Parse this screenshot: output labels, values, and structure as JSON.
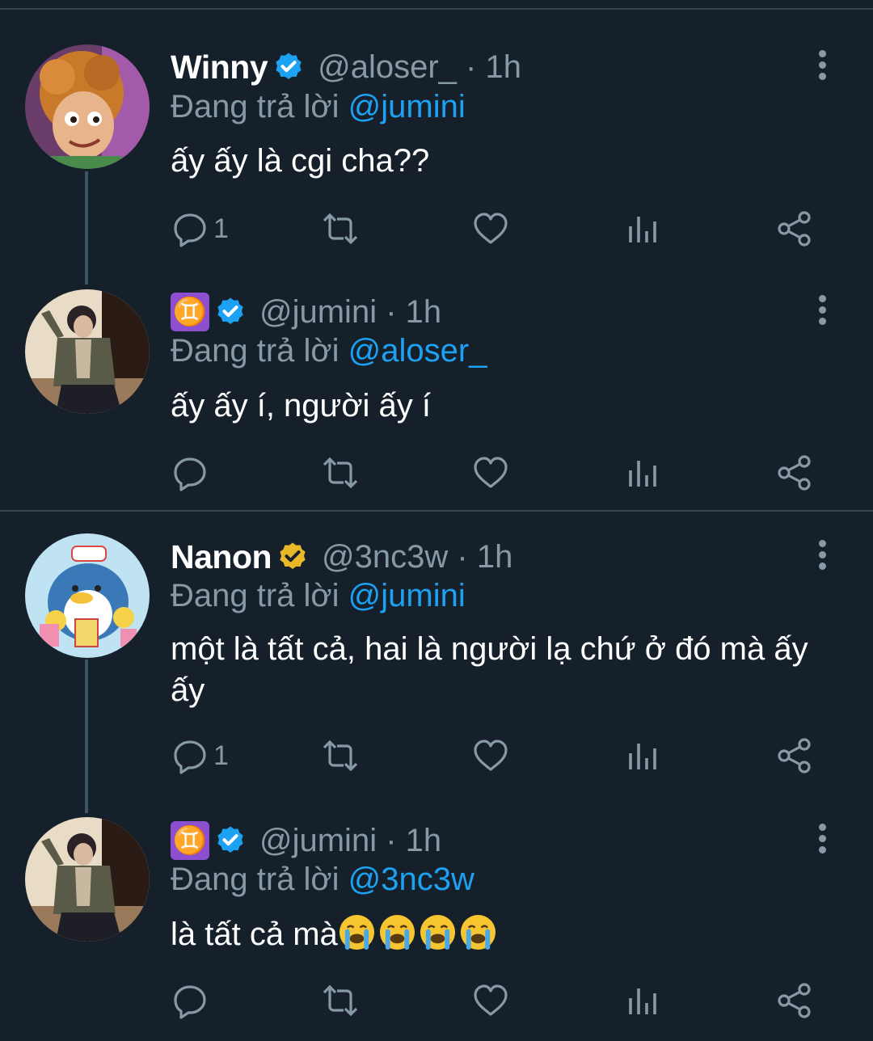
{
  "tweets": [
    {
      "name": "Winny",
      "handle_time": "@aloser_ · 1h",
      "replying_label": "Đang trả lời",
      "replying_to": "@jumini",
      "text": "ấy ấy là cgi cha??",
      "reply_count": "1",
      "verified_color": "#1da1f2"
    },
    {
      "name": "♊",
      "handle_time": "@jumini · 1h",
      "replying_label": "Đang trả lời",
      "replying_to": "@aloser_",
      "text": "ấy ấy í, người ấy í",
      "reply_count": "",
      "verified_color": "#1da1f2"
    },
    {
      "name": "Nanon",
      "handle_time": "@3nc3w · 1h",
      "replying_label": "Đang trả lời",
      "replying_to": "@jumini",
      "text": "một là tất cả, hai là người lạ chứ ở đó mà ấy ấy",
      "reply_count": "1",
      "verified_color": "#e8b829"
    },
    {
      "name": "♊",
      "handle_time": "@jumini · 1h",
      "replying_label": "Đang trả lời",
      "replying_to": "@3nc3w",
      "text": "là tất cả mà",
      "emoji": [
        "😭",
        "😭",
        "😭",
        "😭"
      ],
      "reply_count": "",
      "verified_color": "#1da1f2"
    }
  ],
  "icons": {
    "reply": "reply-icon",
    "retweet": "retweet-icon",
    "like": "heart-icon",
    "analytics": "analytics-icon",
    "share": "share-icon",
    "more": "more-vertical-icon"
  },
  "colors": {
    "background": "#15202b",
    "divider": "#38444d",
    "secondary_text": "#8899a6",
    "link": "#1da1f2",
    "gold_badge": "#e8b829"
  }
}
